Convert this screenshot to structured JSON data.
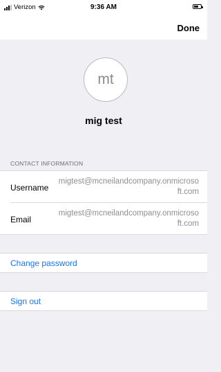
{
  "status_bar": {
    "carrier": "Verizon",
    "time": "9:36 AM",
    "signal_icon": "signal-bars-icon",
    "wifi_icon": "wifi-icon",
    "battery_icon": "battery-icon"
  },
  "nav": {
    "done_label": "Done"
  },
  "profile": {
    "initials": "mt",
    "name": "mig test"
  },
  "contact": {
    "header": "CONTACT INFORMATION",
    "rows": [
      {
        "label": "Username",
        "value": "migtest@mcneilandcompany.onmicrosoft.com"
      },
      {
        "label": "Email",
        "value": "migtest@mcneilandcompany.onmicrosoft.com"
      }
    ]
  },
  "actions": {
    "change_password": "Change password",
    "sign_out": "Sign out"
  },
  "colors": {
    "accent": "#1a73e8",
    "background": "#efeff4",
    "secondary_text": "#8e8e93"
  }
}
